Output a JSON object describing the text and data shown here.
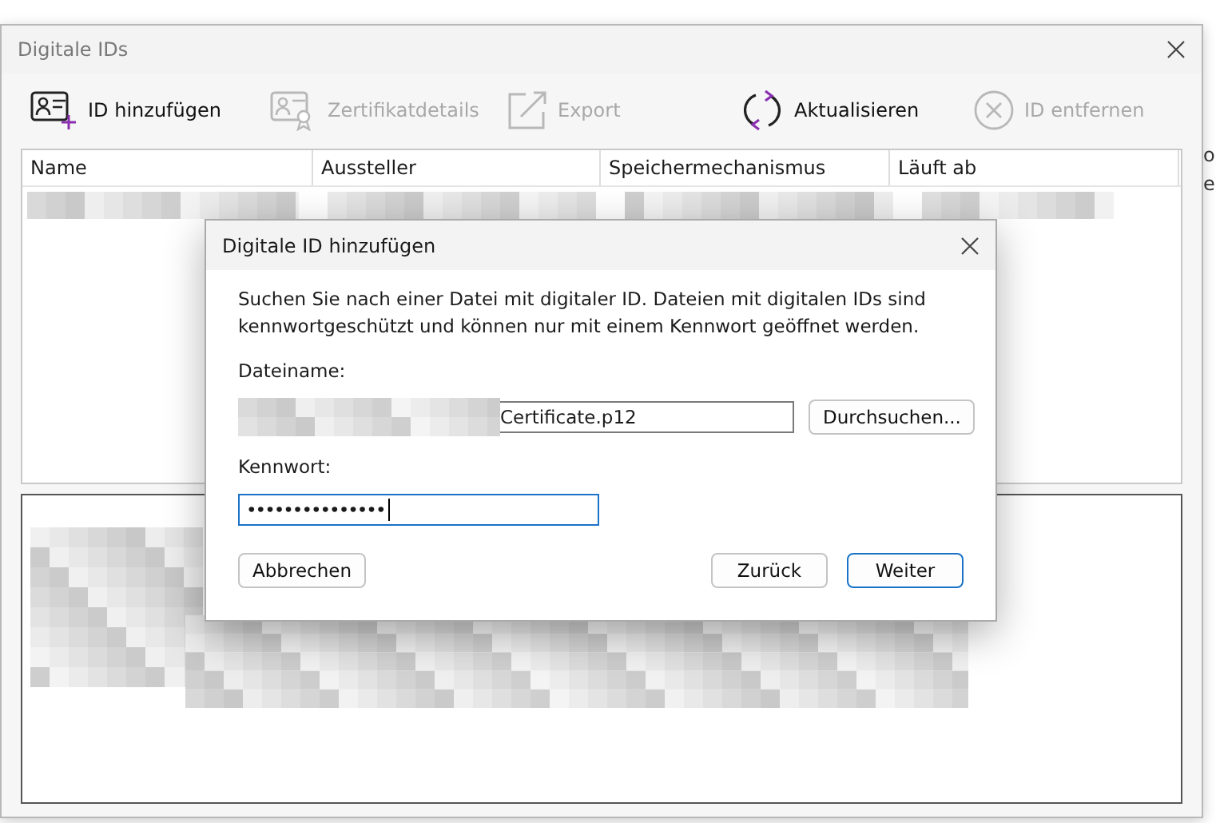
{
  "background_text": [
    "o",
    "e"
  ],
  "window": {
    "title": "Digitale IDs"
  },
  "toolbar": [
    {
      "kind": "add",
      "label": "ID hinzufügen",
      "disabled": false
    },
    {
      "kind": "details",
      "label": "Zertifikatdetails",
      "disabled": true
    },
    {
      "kind": "export",
      "label": "Export",
      "disabled": true
    },
    {
      "kind": "refresh",
      "label": "Aktualisieren",
      "disabled": false
    },
    {
      "kind": "remove",
      "label": "ID entfernen",
      "disabled": true
    }
  ],
  "table": {
    "columns": [
      "Name",
      "Aussteller",
      "Speichermechanismus",
      "Läuft ab"
    ]
  },
  "dialog": {
    "title": "Digitale ID hinzufügen",
    "message": "Suchen Sie nach einer Datei mit digitaler ID. Dateien mit digitalen IDs sind kennwortgeschützt und können nur mit einem Kennwort geöffnet werden.",
    "filename_label": "Dateiname:",
    "filename_value": "Certificate.p12",
    "browse_button": "Durchsuchen...",
    "password_label": "Kennwort:",
    "password_value": "•••••••••••••••",
    "buttons": [
      {
        "kind": "cancel",
        "label": "Abbrechen",
        "default": false
      },
      {
        "kind": "back",
        "label": "Zurück",
        "default": false
      },
      {
        "kind": "next",
        "label": "Weiter",
        "default": true
      }
    ]
  }
}
